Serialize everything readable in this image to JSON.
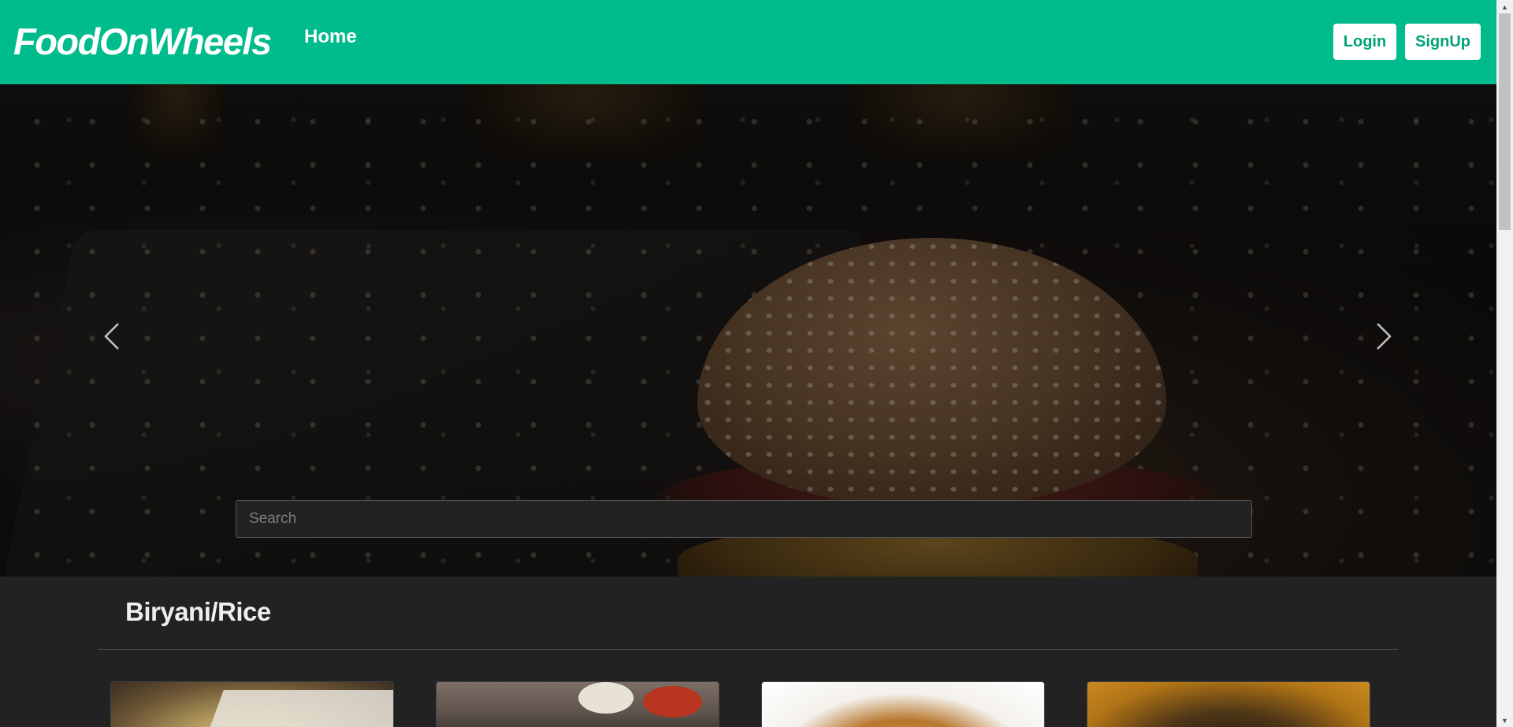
{
  "navbar": {
    "brand": "FoodOnWheels",
    "home_label": "Home",
    "login_label": "Login",
    "signup_label": "SignUp",
    "bg_color": "#00bb8b"
  },
  "hero": {
    "prev_icon": "chevron-left-icon",
    "next_icon": "chevron-right-icon",
    "search": {
      "placeholder": "Search",
      "value": ""
    }
  },
  "category": {
    "title": "Biryani/Rice",
    "cards_visible": 4
  },
  "scrollbar": {
    "up_icon": "triangle-up-icon",
    "down_icon": "triangle-down-icon"
  }
}
